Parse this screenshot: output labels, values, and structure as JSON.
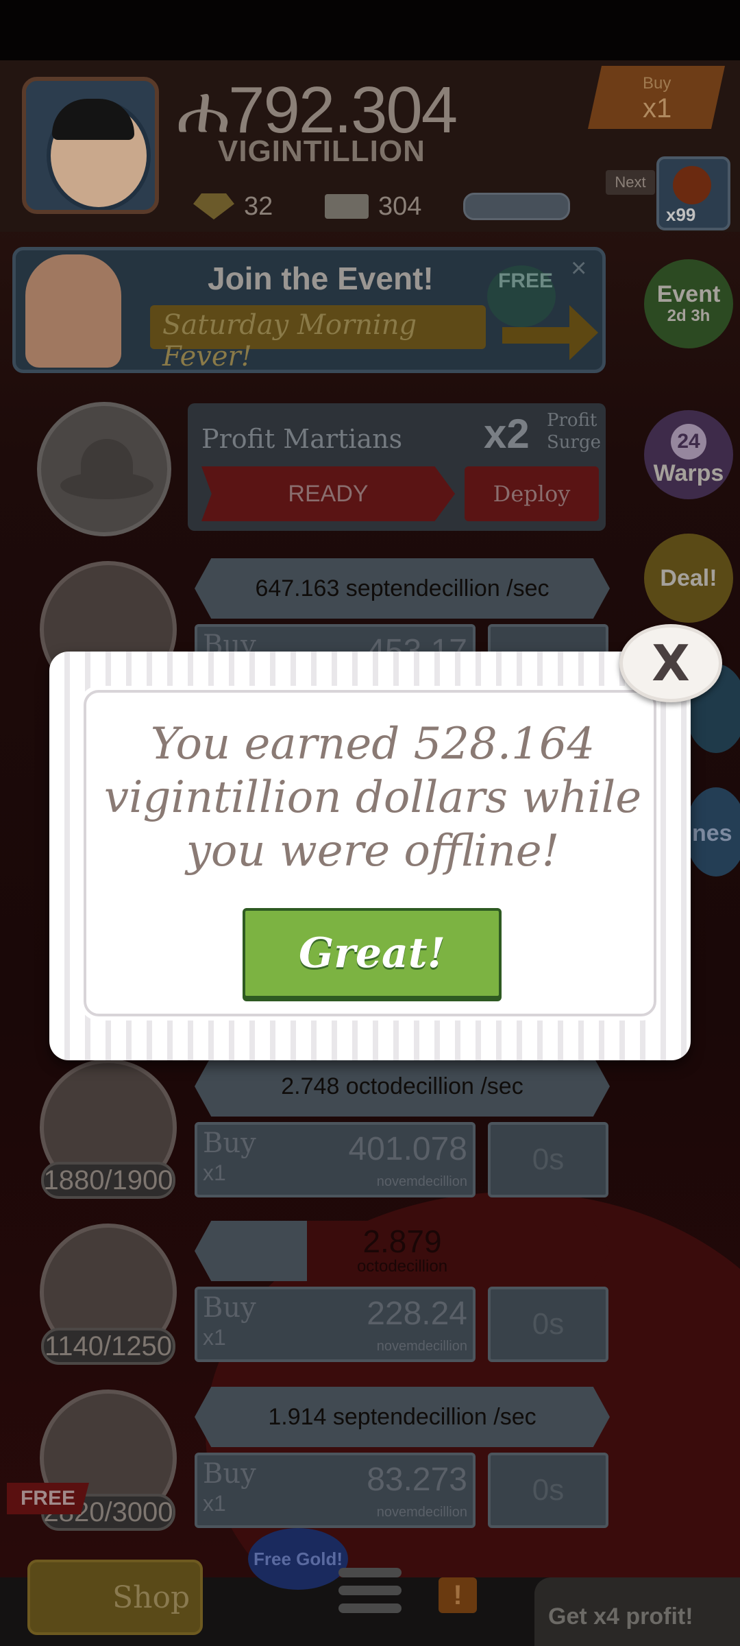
{
  "header": {
    "money_symbol": "ሐ",
    "money_value": "792.304",
    "money_unit": "VIGINTILLION",
    "gold_count": "32",
    "ticket_count": "304",
    "buy_label": "Buy",
    "buy_multiplier": "x1",
    "next_label": "Next",
    "next_count": "x99"
  },
  "event_banner": {
    "title": "Join the Event!",
    "subtitle": "Saturday Morning Fever!",
    "free_label": "FREE",
    "close_label": "×"
  },
  "side_badges": {
    "event_title": "Event",
    "event_time": "2d 3h",
    "warps_count": "24",
    "warps_label": "Warps",
    "deal_label": "Deal!",
    "partial_label": "nes"
  },
  "martians": {
    "title": "Profit Martians",
    "multiplier": "x2",
    "surge_line1": "Profit",
    "surge_line2": "Surge",
    "ready_label": "READY",
    "deploy_label": "Deploy"
  },
  "rows": [
    {
      "rate": "647.163 septendecillion /sec",
      "buy": "Buy",
      "mult": "x1",
      "cost": "453.17",
      "unit": "",
      "timer": "",
      "count": ""
    },
    {
      "rate": "2.748 octodecillion /sec",
      "buy": "Buy",
      "mult": "x1",
      "cost": "401.078",
      "unit": "novemdecillion",
      "timer": "0s",
      "count": "1880/1900"
    },
    {
      "rate_value": "2.879",
      "rate_unit": "octodecillion",
      "progress": 0.27,
      "buy": "Buy",
      "mult": "x1",
      "cost": "228.24",
      "unit": "novemdecillion",
      "timer": "0s",
      "count": "1140/1250"
    },
    {
      "rate": "1.914 septendecillion /sec",
      "buy": "Buy",
      "mult": "x1",
      "cost": "83.273",
      "unit": "novemdecillion",
      "timer": "0s",
      "count": "2820/3000"
    }
  ],
  "bottom": {
    "free_tag": "FREE",
    "shop_label": "Shop",
    "free_gold": "Free Gold!",
    "alert": "!",
    "x4_label": "Get x4 profit!"
  },
  "modal": {
    "message": "You earned 528.164 vigintillion dollars while you were offline!",
    "confirm_label": "Great!",
    "close_label": "X"
  },
  "colors": {
    "great_button": "#7cb342",
    "modal_text": "#8a7a74"
  }
}
